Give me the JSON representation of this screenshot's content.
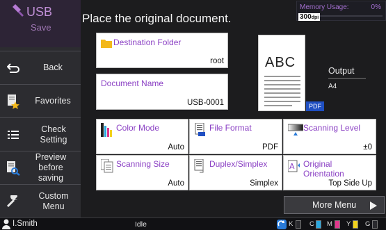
{
  "app": {
    "title": "USB",
    "subtitle": "Save"
  },
  "sidebar": {
    "items": [
      {
        "label": "Back",
        "icon": "back-arrow-icon"
      },
      {
        "label": "Favorites",
        "icon": "favorites-star-icon"
      },
      {
        "label": "Check Setting",
        "icon": "list-icon"
      },
      {
        "label": "Preview before saving",
        "icon": "preview-magnifier-icon"
      },
      {
        "label": "Custom Menu",
        "icon": "wrench-icon"
      }
    ]
  },
  "header": {
    "title": "Place the original document.",
    "memory_label": "Memory Usage:",
    "memory_value": "0%",
    "memory_fraction": 0
  },
  "destination": {
    "label": "Destination Folder",
    "value": "root"
  },
  "document": {
    "label": "Document Name",
    "value": "USB-0001"
  },
  "preview": {
    "resolution": "300",
    "resolution_unit": "dpi",
    "sample_text": "ABC",
    "format_badge": "PDF",
    "output_label": "Output",
    "output_value": "A4"
  },
  "settings": [
    {
      "label": "Color Mode",
      "value": "Auto",
      "icon": "color-mode-icon"
    },
    {
      "label": "File Format",
      "value": "PDF",
      "icon": "file-format-icon"
    },
    {
      "label": "Scanning Level",
      "value": "±0",
      "icon": "scanning-level-icon"
    },
    {
      "label": "Scanning Size",
      "value": "Auto",
      "icon": "scanning-size-icon"
    },
    {
      "label": "Duplex/Simplex",
      "value": "Simplex",
      "icon": "duplex-icon"
    },
    {
      "label": "Original Orientation",
      "value": "Top Side Up",
      "icon": "orientation-icon"
    }
  ],
  "more_menu": {
    "label": "More Menu"
  },
  "status": {
    "user": "I.Smith",
    "state": "Idle",
    "inks": [
      {
        "name": "K",
        "color": "#111111",
        "level": 0
      },
      {
        "name": "C",
        "color": "#29a8e0",
        "level": 1
      },
      {
        "name": "M",
        "color": "#e0378c",
        "level": 1
      },
      {
        "name": "Y",
        "color": "#f2d21c",
        "level": 1
      },
      {
        "name": "G",
        "color": "#9a9a9a",
        "level": 0
      }
    ]
  },
  "colors": {
    "accent": "#8b41c4",
    "folder": "#f3b81b",
    "pdf": "#1f4fc2"
  }
}
